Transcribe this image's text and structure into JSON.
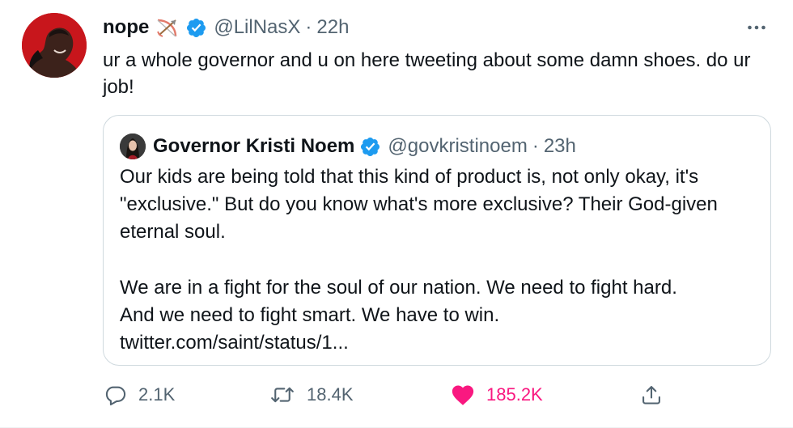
{
  "tweet": {
    "author": {
      "display_name": "nope",
      "emoji_icon": "bow-and-arrow",
      "verified": true,
      "handle": "@LilNasX",
      "time": "22h"
    },
    "more_icon": "more-dots-icon",
    "text": "ur a whole governor and u on here tweeting about some damn shoes. do ur job!",
    "quote": {
      "display_name": "Governor Kristi Noem",
      "verified": true,
      "handle": "@govkristinoem",
      "time": "23h",
      "paragraph_1": "Our kids are being told that this kind of product is, not only okay, it's \"exclusive.\" But do you know what's more exclusive? Their God-given eternal soul.",
      "paragraph_2_line_1": "We are in a fight for the soul of our nation. We need to fight hard.",
      "paragraph_2_line_2": "And we need to fight smart. We have to win.",
      "link": "twitter.com/saint/status/1..."
    },
    "actions": {
      "replies": "2.1K",
      "retweets": "18.4K",
      "likes": "185.2K"
    },
    "colors": {
      "like": "#f91880",
      "verified": "#1d9bf0",
      "secondary_text": "#536471",
      "border": "#cfd9de"
    }
  }
}
